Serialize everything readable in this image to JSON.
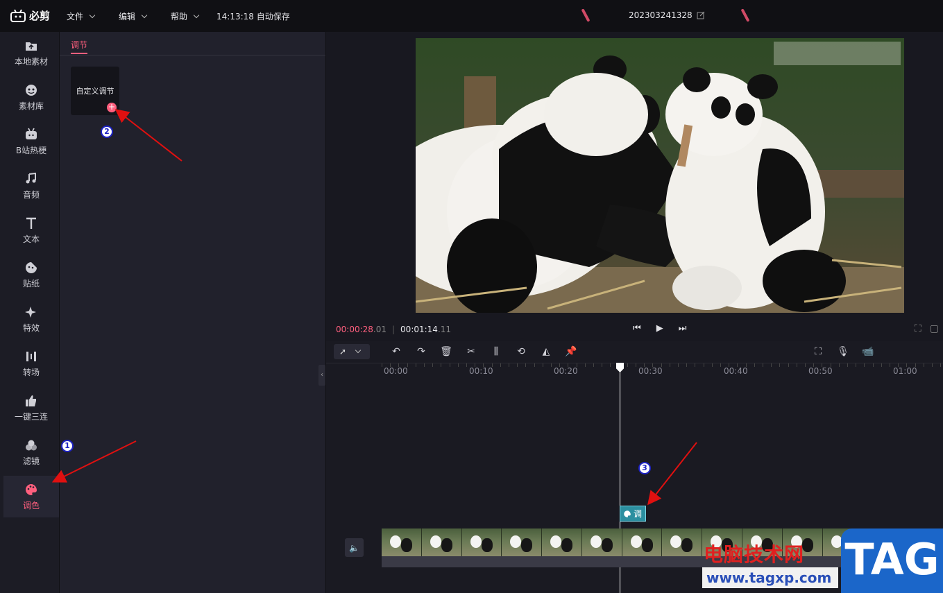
{
  "app": {
    "logo_text": "必剪",
    "menus": [
      {
        "label": "文件"
      },
      {
        "label": "编辑"
      },
      {
        "label": "帮助"
      }
    ],
    "autosave_text": "14:13:18 自动保存",
    "project_name": "202303241328"
  },
  "sidebar": {
    "items": [
      {
        "label": "本地素材",
        "icon": "upload-folder-icon"
      },
      {
        "label": "素材库",
        "icon": "material-library-icon"
      },
      {
        "label": "B站热梗",
        "icon": "bilibili-tv-icon"
      },
      {
        "label": "音频",
        "icon": "music-note-icon"
      },
      {
        "label": "文本",
        "icon": "text-t-icon"
      },
      {
        "label": "贴纸",
        "icon": "sticker-icon"
      },
      {
        "label": "特效",
        "icon": "sparkle-icon"
      },
      {
        "label": "转场",
        "icon": "transition-icon"
      },
      {
        "label": "一键三连",
        "icon": "thumbs-up-icon"
      },
      {
        "label": "滤镜",
        "icon": "filter-circles-icon"
      },
      {
        "label": "调色",
        "icon": "palette-icon"
      }
    ],
    "active": "调色"
  },
  "panel": {
    "tab_label": "调节",
    "card_label": "自定义调节",
    "card_add": "+"
  },
  "preview": {
    "current_time": "00:00:28",
    "current_frames": ".01",
    "separator": "|",
    "total_time": "00:01:14",
    "total_frames": ".11"
  },
  "timeline": {
    "ruler_labels": [
      "00:00",
      "00:10",
      "00:20",
      "00:30",
      "00:40",
      "00:50",
      "01:00"
    ],
    "adjust_clip_label": "调"
  },
  "annotations": {
    "marker1": "1",
    "marker2": "2",
    "marker3": "3"
  },
  "watermark": {
    "site_name": "电脑技术网",
    "url": "www.tagxp.com",
    "tag": "TAG"
  },
  "colors": {
    "accent": "#ff5f7e",
    "clip": "#2c8fa0",
    "arrow": "#e01010",
    "marker_border": "#1d22c4"
  }
}
